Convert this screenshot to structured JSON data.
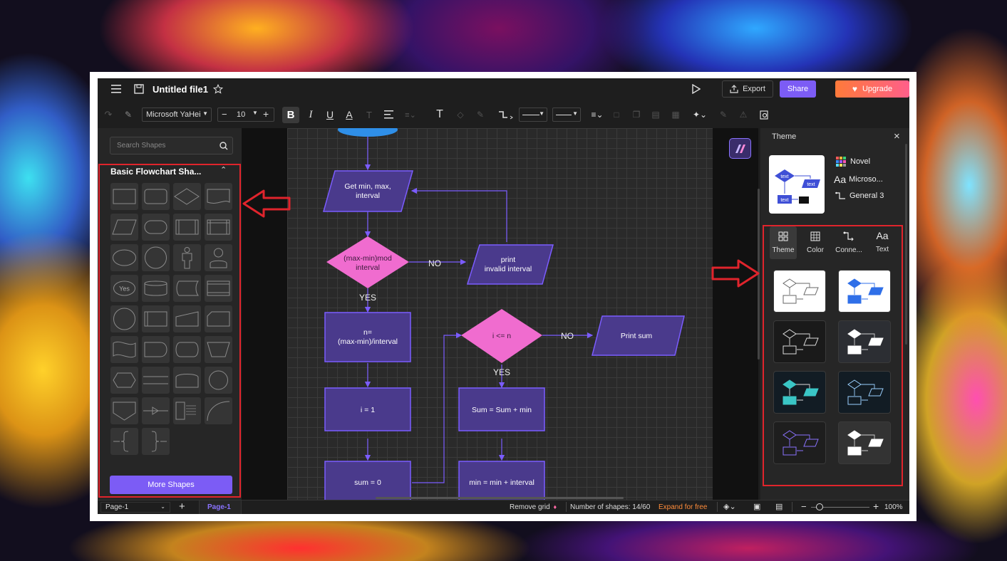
{
  "app": {
    "file_title": "Untitled file1",
    "export_label": "Export",
    "share_label": "Share",
    "upgrade_label": "Upgrade"
  },
  "toolbar": {
    "font_name": "Microsoft YaHei",
    "font_size": "10"
  },
  "left_panel": {
    "search_placeholder": "Search Shapes",
    "section_title": "Basic Flowchart Sha...",
    "more_shapes_label": "More Shapes",
    "yes_shape_label": "Yes"
  },
  "flowchart": {
    "input": "Get min, max,",
    "input2": "interval",
    "decision1": "(max-min)mod",
    "decision1b": "interval",
    "no1": "NO",
    "print_invalid": "print",
    "print_invalid2": "invalid interval",
    "yes1": "YES",
    "n_assign": "n=",
    "n_assign2": "(max-min)/interval",
    "i_assign": "i = 1",
    "sum_assign": "sum = 0",
    "decision2": "i <= n",
    "no2": "NO",
    "print_sum": "Print sum",
    "yes2": "YES",
    "sum_update": "Sum = Sum + min",
    "min_update": "min = min + interval"
  },
  "right_panel": {
    "title": "Theme",
    "theme_name": "Novel",
    "font_theme": "Microso...",
    "connector_theme": "General 3",
    "preview_text": "text",
    "tabs": [
      {
        "label": "Theme"
      },
      {
        "label": "Color"
      },
      {
        "label": "Conne..."
      },
      {
        "label": "Text"
      }
    ],
    "text_tab_icon": "Aa"
  },
  "statusbar": {
    "page_select": "Page-1",
    "page_tab": "Page-1",
    "remove_grid": "Remove grid",
    "shape_count": "Number of shapes: 14/60",
    "expand": "Expand for free",
    "zoom": "100%"
  },
  "colors": {
    "accent_purple": "#7c5cf5",
    "upgrade_orange": "#ff6a3d",
    "decision_pink": "#f06ccf",
    "process_fill": "#4a3a8c",
    "process_stroke": "#7b5cff",
    "annotation_red": "#e0242c"
  }
}
